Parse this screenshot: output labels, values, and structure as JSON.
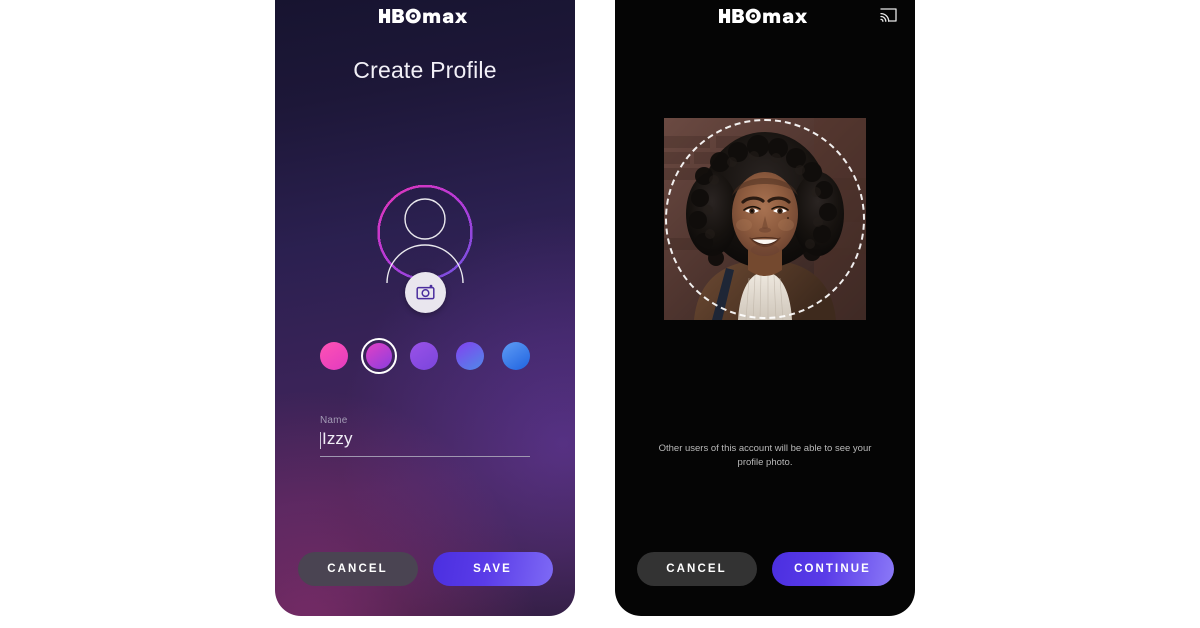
{
  "brand": {
    "logo_text": "HBOmax",
    "accent_gradient_start": "#4b2fe0",
    "accent_gradient_end": "#8b79f7"
  },
  "screens": {
    "create_profile": {
      "title": "Create Profile",
      "avatar": {
        "icon": "person-silhouette-icon",
        "camera_badge_icon": "camera-icon",
        "ring_gradient_start": "#f03bb0",
        "ring_gradient_end": "#5a63e8"
      },
      "color_swatches": [
        {
          "name": "swatch-pink",
          "gradient_start": "#ff52b4",
          "gradient_end": "#e23bc0",
          "selected": false
        },
        {
          "name": "swatch-magenta",
          "gradient_start": "#e240c4",
          "gradient_end": "#8c3ee0",
          "selected": true
        },
        {
          "name": "swatch-purple",
          "gradient_start": "#9a52e8",
          "gradient_end": "#7a45dc",
          "selected": false
        },
        {
          "name": "swatch-violet-blue",
          "gradient_start": "#8341f0",
          "gradient_end": "#4f8ae8",
          "selected": false
        },
        {
          "name": "swatch-blue",
          "gradient_start": "#5f9cf5",
          "gradient_end": "#1f63e0",
          "selected": false
        }
      ],
      "name_field": {
        "label": "Name",
        "value": "Izzy",
        "placeholder": "Name"
      },
      "buttons": {
        "cancel": "CANCEL",
        "save": "SAVE"
      }
    },
    "profile_photo": {
      "cast_icon": "cast-icon",
      "photo_alt": "profile-photo",
      "crop_guide": "dashed-circle-crop-guide",
      "note": "Other users of this account will be able to see your profile photo.",
      "buttons": {
        "cancel": "CANCEL",
        "continue": "CONTINUE"
      }
    }
  }
}
